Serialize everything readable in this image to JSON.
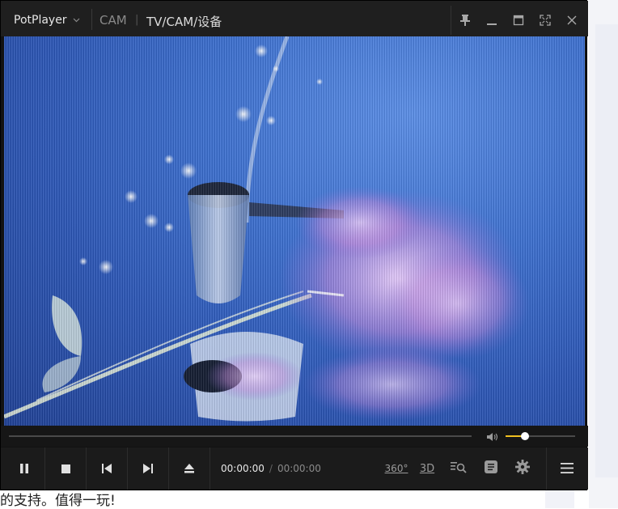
{
  "app": {
    "name": "PotPlayer",
    "dropdown_icon": "chevron-down-icon"
  },
  "titlebar": {
    "mode_label": "CAM",
    "source_label": "TV/CAM/设备",
    "buttons": [
      "pin-icon",
      "minimize-icon",
      "maximize-icon",
      "fullscreen-icon",
      "close-icon"
    ]
  },
  "playback": {
    "current_time": "00:00:00",
    "separator": "/",
    "total_time": "00:00:00",
    "seek_progress": 0,
    "volume_level": 0.28
  },
  "controls": {
    "left_buttons": [
      "pause-icon",
      "stop-icon",
      "previous-icon",
      "next-icon",
      "eject-icon"
    ],
    "right_buttons": {
      "vr": "360°",
      "three_d": "3D"
    },
    "menu_icon": "menu-icon"
  },
  "background_page": {
    "text": "的支持。值得一玩!"
  },
  "colors": {
    "accent": "#f0c020",
    "titlebar": "#1f1f1f",
    "controls": "#1b1b1b"
  }
}
